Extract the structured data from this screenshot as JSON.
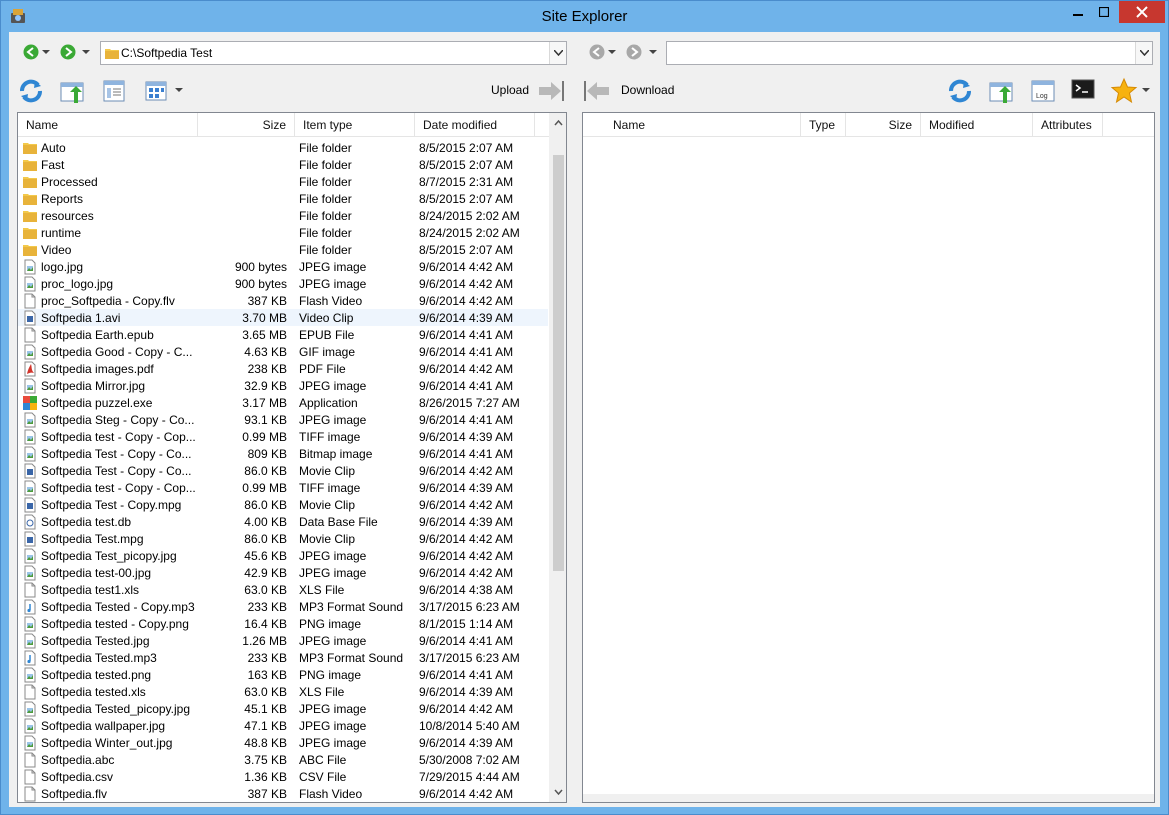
{
  "window": {
    "title": "Site Explorer"
  },
  "left": {
    "path": "C:\\Softpedia Test",
    "columns": {
      "name": "Name",
      "size": "Size",
      "type": "Item type",
      "date": "Date modified"
    },
    "files": [
      {
        "name": "Auto",
        "size": "",
        "type": "File folder",
        "date": "8/5/2015 2:07 AM",
        "icon": "folder"
      },
      {
        "name": "Fast",
        "size": "",
        "type": "File folder",
        "date": "8/5/2015 2:07 AM",
        "icon": "folder"
      },
      {
        "name": "Processed",
        "size": "",
        "type": "File folder",
        "date": "8/7/2015 2:31 AM",
        "icon": "folder"
      },
      {
        "name": "Reports",
        "size": "",
        "type": "File folder",
        "date": "8/5/2015 2:07 AM",
        "icon": "folder"
      },
      {
        "name": "resources",
        "size": "",
        "type": "File folder",
        "date": "8/24/2015 2:02 AM",
        "icon": "folder"
      },
      {
        "name": "runtime",
        "size": "",
        "type": "File folder",
        "date": "8/24/2015 2:02 AM",
        "icon": "folder"
      },
      {
        "name": "Video",
        "size": "",
        "type": "File folder",
        "date": "8/5/2015 2:07 AM",
        "icon": "folder"
      },
      {
        "name": "logo.jpg",
        "size": "900 bytes",
        "type": "JPEG image",
        "date": "9/6/2014 4:42 AM",
        "icon": "image"
      },
      {
        "name": "proc_logo.jpg",
        "size": "900 bytes",
        "type": "JPEG image",
        "date": "9/6/2014 4:42 AM",
        "icon": "image"
      },
      {
        "name": "proc_Softpedia - Copy.flv",
        "size": "387 KB",
        "type": "Flash Video",
        "date": "9/6/2014 4:42 AM",
        "icon": "file"
      },
      {
        "name": "Softpedia 1.avi",
        "size": "3.70 MB",
        "type": "Video Clip",
        "date": "9/6/2014 4:39 AM",
        "icon": "video",
        "highlight": true
      },
      {
        "name": "Softpedia Earth.epub",
        "size": "3.65 MB",
        "type": "EPUB File",
        "date": "9/6/2014 4:41 AM",
        "icon": "file"
      },
      {
        "name": "Softpedia Good - Copy - C...",
        "size": "4.63 KB",
        "type": "GIF image",
        "date": "9/6/2014 4:41 AM",
        "icon": "image"
      },
      {
        "name": "Softpedia images.pdf",
        "size": "238 KB",
        "type": "PDF File",
        "date": "9/6/2014 4:42 AM",
        "icon": "pdf"
      },
      {
        "name": "Softpedia Mirror.jpg",
        "size": "32.9 KB",
        "type": "JPEG image",
        "date": "9/6/2014 4:41 AM",
        "icon": "image"
      },
      {
        "name": "Softpedia puzzel.exe",
        "size": "3.17 MB",
        "type": "Application",
        "date": "8/26/2015 7:27 AM",
        "icon": "app"
      },
      {
        "name": "Softpedia Steg - Copy - Co...",
        "size": "93.1 KB",
        "type": "JPEG image",
        "date": "9/6/2014 4:41 AM",
        "icon": "image"
      },
      {
        "name": "Softpedia test - Copy - Cop...",
        "size": "0.99 MB",
        "type": "TIFF image",
        "date": "9/6/2014 4:39 AM",
        "icon": "image"
      },
      {
        "name": "Softpedia Test - Copy - Co...",
        "size": "809 KB",
        "type": "Bitmap image",
        "date": "9/6/2014 4:41 AM",
        "icon": "image"
      },
      {
        "name": "Softpedia Test - Copy - Co...",
        "size": "86.0 KB",
        "type": "Movie Clip",
        "date": "9/6/2014 4:42 AM",
        "icon": "video"
      },
      {
        "name": "Softpedia test - Copy - Cop...",
        "size": "0.99 MB",
        "type": "TIFF image",
        "date": "9/6/2014 4:39 AM",
        "icon": "image"
      },
      {
        "name": "Softpedia Test - Copy.mpg",
        "size": "86.0 KB",
        "type": "Movie Clip",
        "date": "9/6/2014 4:42 AM",
        "icon": "video"
      },
      {
        "name": "Softpedia test.db",
        "size": "4.00 KB",
        "type": "Data Base File",
        "date": "9/6/2014 4:39 AM",
        "icon": "db"
      },
      {
        "name": "Softpedia Test.mpg",
        "size": "86.0 KB",
        "type": "Movie Clip",
        "date": "9/6/2014 4:42 AM",
        "icon": "video"
      },
      {
        "name": "Softpedia Test_picopy.jpg",
        "size": "45.6 KB",
        "type": "JPEG image",
        "date": "9/6/2014 4:42 AM",
        "icon": "image"
      },
      {
        "name": "Softpedia test-00.jpg",
        "size": "42.9 KB",
        "type": "JPEG image",
        "date": "9/6/2014 4:42 AM",
        "icon": "image"
      },
      {
        "name": "Softpedia test1.xls",
        "size": "63.0 KB",
        "type": "XLS File",
        "date": "9/6/2014 4:38 AM",
        "icon": "file"
      },
      {
        "name": "Softpedia Tested - Copy.mp3",
        "size": "233 KB",
        "type": "MP3 Format Sound",
        "date": "3/17/2015 6:23 AM",
        "icon": "audio"
      },
      {
        "name": "Softpedia tested - Copy.png",
        "size": "16.4 KB",
        "type": "PNG image",
        "date": "8/1/2015 1:14 AM",
        "icon": "image"
      },
      {
        "name": "Softpedia Tested.jpg",
        "size": "1.26 MB",
        "type": "JPEG image",
        "date": "9/6/2014 4:41 AM",
        "icon": "image"
      },
      {
        "name": "Softpedia Tested.mp3",
        "size": "233 KB",
        "type": "MP3 Format Sound",
        "date": "3/17/2015 6:23 AM",
        "icon": "audio"
      },
      {
        "name": "Softpedia tested.png",
        "size": "163 KB",
        "type": "PNG image",
        "date": "9/6/2014 4:41 AM",
        "icon": "image"
      },
      {
        "name": "Softpedia tested.xls",
        "size": "63.0 KB",
        "type": "XLS File",
        "date": "9/6/2014 4:39 AM",
        "icon": "file"
      },
      {
        "name": "Softpedia Tested_picopy.jpg",
        "size": "45.1 KB",
        "type": "JPEG image",
        "date": "9/6/2014 4:42 AM",
        "icon": "image"
      },
      {
        "name": "Softpedia wallpaper.jpg",
        "size": "47.1 KB",
        "type": "JPEG image",
        "date": "10/8/2014 5:40 AM",
        "icon": "image"
      },
      {
        "name": "Softpedia Winter_out.jpg",
        "size": "48.8 KB",
        "type": "JPEG image",
        "date": "9/6/2014 4:39 AM",
        "icon": "image"
      },
      {
        "name": "Softpedia.abc",
        "size": "3.75 KB",
        "type": "ABC File",
        "date": "5/30/2008 7:02 AM",
        "icon": "file"
      },
      {
        "name": "Softpedia.csv",
        "size": "1.36 KB",
        "type": "CSV File",
        "date": "7/29/2015 4:44 AM",
        "icon": "file"
      },
      {
        "name": "Softpedia.flv",
        "size": "387 KB",
        "type": "Flash Video",
        "date": "9/6/2014 4:42 AM",
        "icon": "file"
      }
    ]
  },
  "right": {
    "path": "",
    "columns": {
      "name": "Name",
      "type": "Type",
      "size": "Size",
      "modified": "Modified",
      "attributes": "Attributes"
    }
  },
  "transfer": {
    "upload": "Upload",
    "download": "Download"
  },
  "log_label": "Log",
  "colors": {
    "titlebar": "#6fb3ea",
    "close": "#c7372f",
    "folder": "#f3c94b",
    "accent": "#2f86d3"
  }
}
